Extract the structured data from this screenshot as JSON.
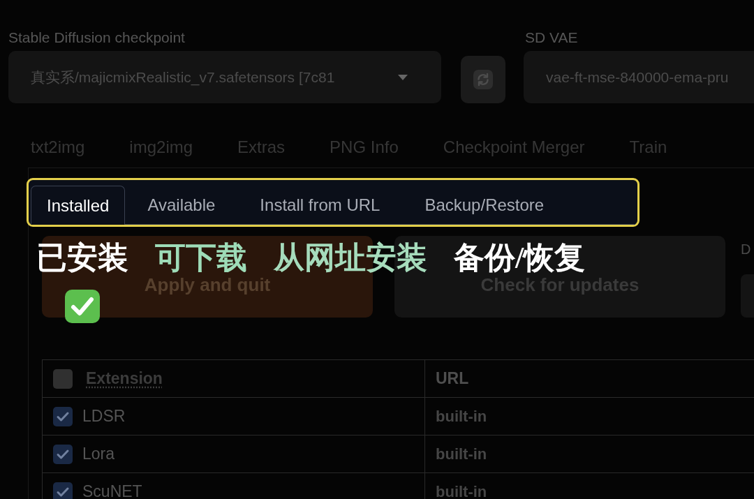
{
  "checkpoint": {
    "label": "Stable Diffusion checkpoint",
    "value": "真实系/majicmixRealistic_v7.safetensors [7c81"
  },
  "vae": {
    "label": "SD VAE",
    "value": "vae-ft-mse-840000-ema-pru"
  },
  "main_tabs": [
    {
      "label": "txt2img",
      "selected": false
    },
    {
      "label": "img2img",
      "selected": false
    },
    {
      "label": "Extras",
      "selected": false
    },
    {
      "label": "PNG Info",
      "selected": false
    },
    {
      "label": "Checkpoint Merger",
      "selected": false
    },
    {
      "label": "Train",
      "selected": false
    }
  ],
  "extension_tabs": [
    {
      "label": "Installed",
      "selected": true
    },
    {
      "label": "Available",
      "selected": false
    },
    {
      "label": "Install from URL",
      "selected": false
    },
    {
      "label": "Backup/Restore",
      "selected": false
    }
  ],
  "annotations": [
    {
      "text": "已安装",
      "color": "#ffffff"
    },
    {
      "text": "可下载",
      "color": "#9edcb8"
    },
    {
      "text": "从网址安装",
      "color": "#a6dcbc"
    },
    {
      "text": "备份/恢复",
      "color": "#ffffff"
    }
  ],
  "buttons": [
    {
      "label": "Apply and quit",
      "kind": "primary"
    },
    {
      "label": "Check for updates",
      "kind": "secondary"
    }
  ],
  "column_3": {
    "label": "D"
  },
  "table": {
    "select_all": {
      "checked": false
    },
    "columns": [
      {
        "label": "Extension"
      },
      {
        "label": "URL"
      }
    ],
    "rows": [
      {
        "name": "LDSR",
        "url": "built-in",
        "checked": true
      },
      {
        "name": "Lora",
        "url": "built-in",
        "checked": true
      },
      {
        "name": "ScuNET",
        "url": "built-in",
        "checked": true
      }
    ]
  }
}
